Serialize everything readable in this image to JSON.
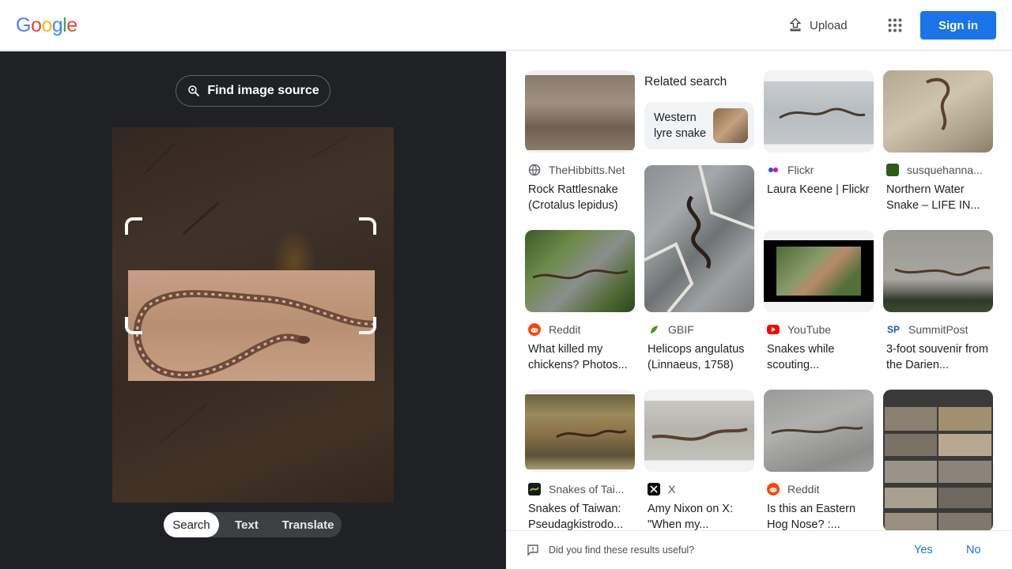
{
  "header": {
    "logo_letters": [
      "G",
      "o",
      "o",
      "g",
      "l",
      "e"
    ],
    "upload_label": "Upload",
    "apps_icon": "apps-grid-icon",
    "signin_label": "Sign in"
  },
  "left": {
    "find_source_label": "Find image source",
    "tabs": [
      {
        "label": "Search",
        "active": true
      },
      {
        "label": "Text",
        "active": false
      },
      {
        "label": "Translate",
        "active": false
      }
    ]
  },
  "related": {
    "heading": "Related search",
    "chip_label": "Western lyre snake"
  },
  "results": [
    {
      "source": "TheHibbitts.Net",
      "title": "Rock Rattlesnake (Crotalus lepidus)",
      "favicon": "globe-icon"
    },
    {
      "source": "Flickr",
      "title": "Laura Keene | Flickr",
      "favicon": "flickr-icon"
    },
    {
      "source": "susquehanna...",
      "title": "Northern Water Snake – LIFE IN...",
      "favicon": "susquehanna-icon"
    },
    {
      "source": "GBIF",
      "title": "Helicops angulatus (Linnaeus, 1758)",
      "favicon": "gbif-icon"
    },
    {
      "source": "Reddit",
      "title": "What killed my chickens? Photos...",
      "favicon": "reddit-icon"
    },
    {
      "source": "YouTube",
      "title": "Snakes while scouting...",
      "favicon": "youtube-icon"
    },
    {
      "source": "SummitPost",
      "title": "3-foot souvenir from the Darien...",
      "favicon": "summitpost-icon",
      "favicon_text": "SP"
    },
    {
      "source": "Snakes of Tai...",
      "title": "Snakes of Taiwan: Pseudagkistrodo...",
      "favicon": "snakes-taiwan-icon"
    },
    {
      "source": "X",
      "title": "Amy Nixon on X: \"When my...",
      "favicon": "x-icon"
    },
    {
      "source": "Reddit",
      "title": "Is this an Eastern Hog Nose? :...",
      "favicon": "reddit-icon"
    }
  ],
  "feedback": {
    "question": "Did you find these results useful?",
    "yes": "Yes",
    "no": "No"
  }
}
